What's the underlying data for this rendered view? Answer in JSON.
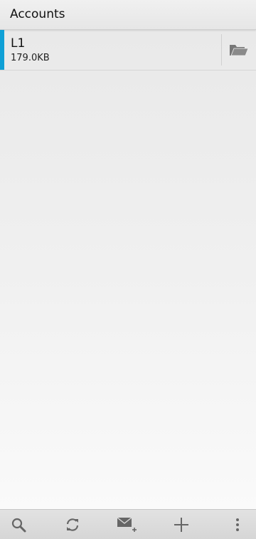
{
  "header": {
    "title": "Accounts"
  },
  "accounts": [
    {
      "name": "L1",
      "size": "179.0KB",
      "accent_color": "#0fa0d6"
    }
  ],
  "toolbar": {
    "items": [
      {
        "icon": "search-icon"
      },
      {
        "icon": "refresh-icon"
      },
      {
        "icon": "compose-mail-icon"
      },
      {
        "icon": "plus-icon"
      },
      {
        "icon": "overflow-menu-icon"
      }
    ]
  }
}
